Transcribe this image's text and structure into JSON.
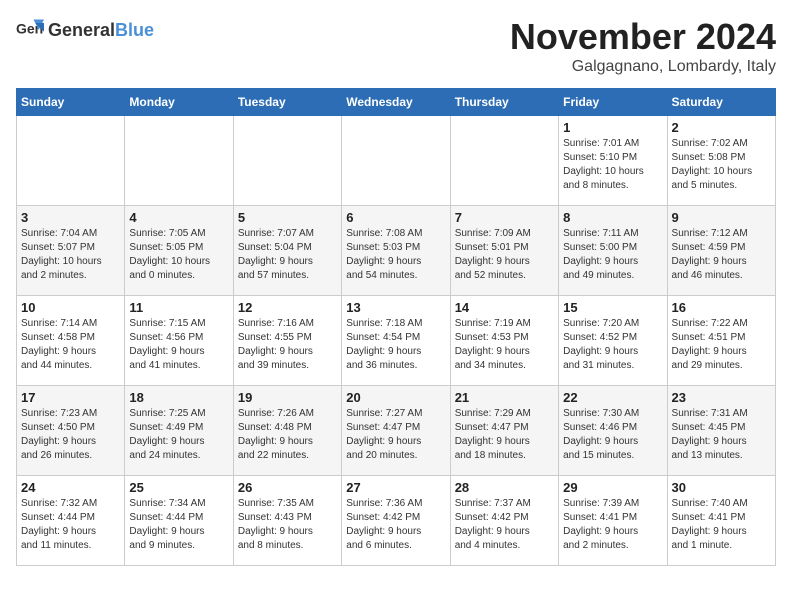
{
  "header": {
    "logo_general": "General",
    "logo_blue": "Blue",
    "month": "November 2024",
    "location": "Galgagnano, Lombardy, Italy"
  },
  "days_of_week": [
    "Sunday",
    "Monday",
    "Tuesday",
    "Wednesday",
    "Thursday",
    "Friday",
    "Saturday"
  ],
  "weeks": [
    [
      {
        "day": "",
        "info": ""
      },
      {
        "day": "",
        "info": ""
      },
      {
        "day": "",
        "info": ""
      },
      {
        "day": "",
        "info": ""
      },
      {
        "day": "",
        "info": ""
      },
      {
        "day": "1",
        "info": "Sunrise: 7:01 AM\nSunset: 5:10 PM\nDaylight: 10 hours\nand 8 minutes."
      },
      {
        "day": "2",
        "info": "Sunrise: 7:02 AM\nSunset: 5:08 PM\nDaylight: 10 hours\nand 5 minutes."
      }
    ],
    [
      {
        "day": "3",
        "info": "Sunrise: 7:04 AM\nSunset: 5:07 PM\nDaylight: 10 hours\nand 2 minutes."
      },
      {
        "day": "4",
        "info": "Sunrise: 7:05 AM\nSunset: 5:05 PM\nDaylight: 10 hours\nand 0 minutes."
      },
      {
        "day": "5",
        "info": "Sunrise: 7:07 AM\nSunset: 5:04 PM\nDaylight: 9 hours\nand 57 minutes."
      },
      {
        "day": "6",
        "info": "Sunrise: 7:08 AM\nSunset: 5:03 PM\nDaylight: 9 hours\nand 54 minutes."
      },
      {
        "day": "7",
        "info": "Sunrise: 7:09 AM\nSunset: 5:01 PM\nDaylight: 9 hours\nand 52 minutes."
      },
      {
        "day": "8",
        "info": "Sunrise: 7:11 AM\nSunset: 5:00 PM\nDaylight: 9 hours\nand 49 minutes."
      },
      {
        "day": "9",
        "info": "Sunrise: 7:12 AM\nSunset: 4:59 PM\nDaylight: 9 hours\nand 46 minutes."
      }
    ],
    [
      {
        "day": "10",
        "info": "Sunrise: 7:14 AM\nSunset: 4:58 PM\nDaylight: 9 hours\nand 44 minutes."
      },
      {
        "day": "11",
        "info": "Sunrise: 7:15 AM\nSunset: 4:56 PM\nDaylight: 9 hours\nand 41 minutes."
      },
      {
        "day": "12",
        "info": "Sunrise: 7:16 AM\nSunset: 4:55 PM\nDaylight: 9 hours\nand 39 minutes."
      },
      {
        "day": "13",
        "info": "Sunrise: 7:18 AM\nSunset: 4:54 PM\nDaylight: 9 hours\nand 36 minutes."
      },
      {
        "day": "14",
        "info": "Sunrise: 7:19 AM\nSunset: 4:53 PM\nDaylight: 9 hours\nand 34 minutes."
      },
      {
        "day": "15",
        "info": "Sunrise: 7:20 AM\nSunset: 4:52 PM\nDaylight: 9 hours\nand 31 minutes."
      },
      {
        "day": "16",
        "info": "Sunrise: 7:22 AM\nSunset: 4:51 PM\nDaylight: 9 hours\nand 29 minutes."
      }
    ],
    [
      {
        "day": "17",
        "info": "Sunrise: 7:23 AM\nSunset: 4:50 PM\nDaylight: 9 hours\nand 26 minutes."
      },
      {
        "day": "18",
        "info": "Sunrise: 7:25 AM\nSunset: 4:49 PM\nDaylight: 9 hours\nand 24 minutes."
      },
      {
        "day": "19",
        "info": "Sunrise: 7:26 AM\nSunset: 4:48 PM\nDaylight: 9 hours\nand 22 minutes."
      },
      {
        "day": "20",
        "info": "Sunrise: 7:27 AM\nSunset: 4:47 PM\nDaylight: 9 hours\nand 20 minutes."
      },
      {
        "day": "21",
        "info": "Sunrise: 7:29 AM\nSunset: 4:47 PM\nDaylight: 9 hours\nand 18 minutes."
      },
      {
        "day": "22",
        "info": "Sunrise: 7:30 AM\nSunset: 4:46 PM\nDaylight: 9 hours\nand 15 minutes."
      },
      {
        "day": "23",
        "info": "Sunrise: 7:31 AM\nSunset: 4:45 PM\nDaylight: 9 hours\nand 13 minutes."
      }
    ],
    [
      {
        "day": "24",
        "info": "Sunrise: 7:32 AM\nSunset: 4:44 PM\nDaylight: 9 hours\nand 11 minutes."
      },
      {
        "day": "25",
        "info": "Sunrise: 7:34 AM\nSunset: 4:44 PM\nDaylight: 9 hours\nand 9 minutes."
      },
      {
        "day": "26",
        "info": "Sunrise: 7:35 AM\nSunset: 4:43 PM\nDaylight: 9 hours\nand 8 minutes."
      },
      {
        "day": "27",
        "info": "Sunrise: 7:36 AM\nSunset: 4:42 PM\nDaylight: 9 hours\nand 6 minutes."
      },
      {
        "day": "28",
        "info": "Sunrise: 7:37 AM\nSunset: 4:42 PM\nDaylight: 9 hours\nand 4 minutes."
      },
      {
        "day": "29",
        "info": "Sunrise: 7:39 AM\nSunset: 4:41 PM\nDaylight: 9 hours\nand 2 minutes."
      },
      {
        "day": "30",
        "info": "Sunrise: 7:40 AM\nSunset: 4:41 PM\nDaylight: 9 hours\nand 1 minute."
      }
    ]
  ]
}
